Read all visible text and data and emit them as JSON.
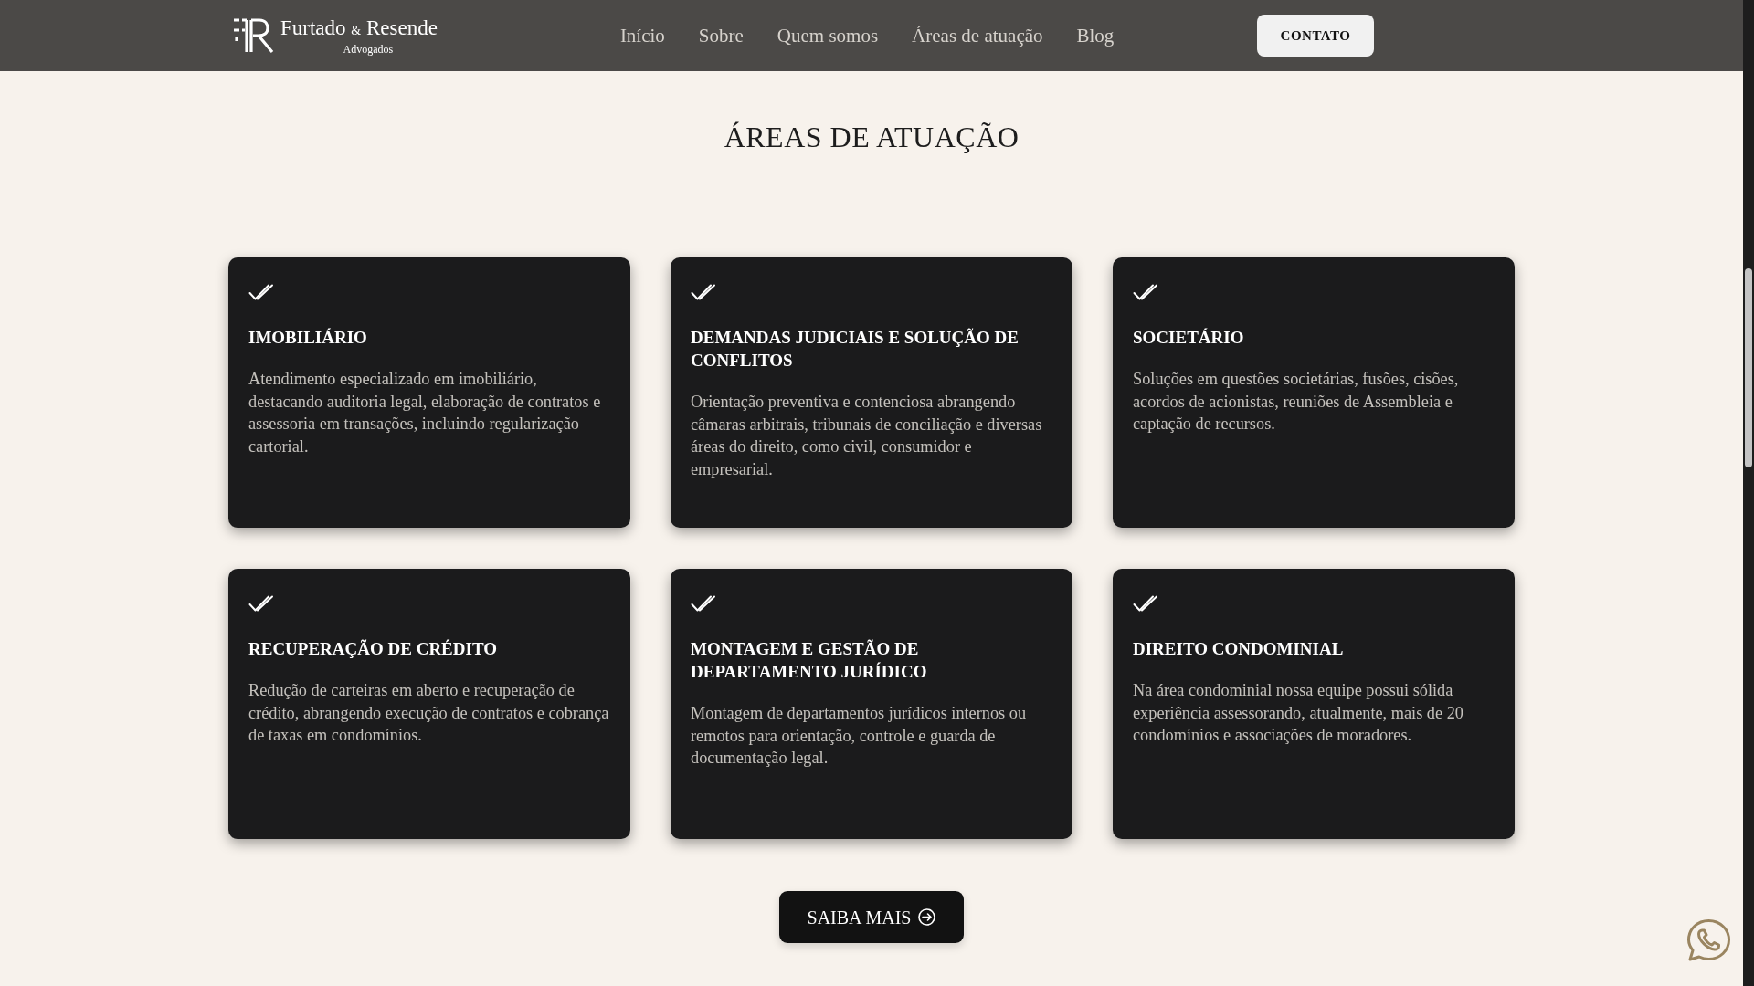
{
  "header": {
    "brand": {
      "name_parts": [
        {
          "text": "Furtado",
          "kind": "word"
        },
        {
          "text": "&",
          "kind": "ampersand"
        },
        {
          "text": "Resende",
          "kind": "word"
        }
      ],
      "tagline": "Advogados"
    },
    "nav": [
      {
        "label": "Início"
      },
      {
        "label": "Sobre"
      },
      {
        "label": "Quem somos"
      },
      {
        "label": "Áreas de atuação"
      },
      {
        "label": "Blog"
      }
    ],
    "contact_button": {
      "label": "CONTATO"
    }
  },
  "section": {
    "title": "ÁREAS DE ATUAÇÃO",
    "cards": [
      {
        "title": "IMOBILIÁRIO",
        "description": "Atendimento especializado em imobiliário, destacando auditoria legal, elaboração de contratos e assessoria em transações, incluindo regularização cartorial."
      },
      {
        "title": "DEMANDAS JUDICIAIS E SOLUÇÃO DE CONFLITOS",
        "description": "Orientação preventiva e contenciosa abrangendo câmaras arbitrais, tribunais de conciliação e diversas áreas do direito, como civil, consumidor e empresarial."
      },
      {
        "title": "SOCIETÁRIO",
        "description": "Soluções em questões societárias, fusões, cisões, acordos de acionistas, reuniões de Assembleia e captação de recursos."
      },
      {
        "title": "RECUPERAÇÃO DE CRÉDITO",
        "description": "Redução de carteiras em aberto e recuperação de crédito, abrangendo execução de contratos e cobrança de taxas em condomínios."
      },
      {
        "title": "MONTAGEM E GESTÃO DE DEPARTAMENTO JURÍDICO",
        "description": "Montagem de departamentos jurídicos internos ou remotos para orientação, controle e guarda de documentação legal."
      },
      {
        "title": "DIREITO CONDOMINIAL",
        "description": "Na área condominial nossa equipe possui sólida experiência assessorando, atualmente, mais de 20 condomínios e associações de moradores."
      }
    ],
    "more_button": {
      "label": "SAIBA MAIS"
    }
  }
}
